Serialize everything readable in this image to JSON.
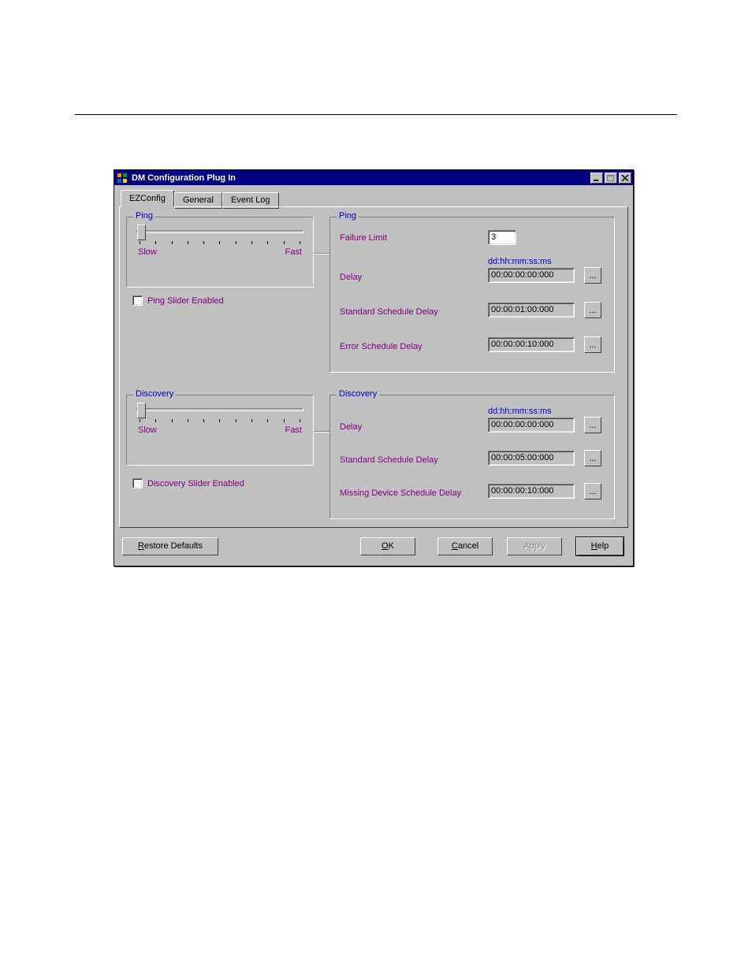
{
  "window": {
    "title": "DM Configuration Plug In"
  },
  "tabs": {
    "ezconfig": "EZConfig",
    "general": "General",
    "eventlog": "Event Log"
  },
  "ping_left": {
    "legend": "Ping",
    "slow": "Slow",
    "fast": "Fast",
    "slider_enabled_label": "Ping Slider Enabled"
  },
  "discovery_left": {
    "legend": "Discovery",
    "slow": "Slow",
    "fast": "Fast",
    "slider_enabled_label": "Discovery Slider Enabled"
  },
  "ping_right": {
    "legend": "Ping",
    "failure_limit_label": "Failure Limit",
    "failure_limit_value": "3",
    "format_hint": "dd:hh:mm:ss:ms",
    "delay_label": "Delay",
    "delay_value": "00:00:00:00:000",
    "std_delay_label": "Standard Schedule Delay",
    "std_delay_value": "00:00:01:00:000",
    "err_delay_label": "Error Schedule Delay",
    "err_delay_value": "00:00:00:10:000",
    "browse": "..."
  },
  "discovery_right": {
    "legend": "Discovery",
    "format_hint": "dd:hh:mm:ss:ms",
    "delay_label": "Delay",
    "delay_value": "00:00:00:00:000",
    "std_delay_label": "Standard Schedule Delay",
    "std_delay_value": "00:00:05:00:000",
    "missing_delay_label": "Missing Device Schedule Delay",
    "missing_delay_value": "00:00:00:10:000",
    "browse": "..."
  },
  "buttons": {
    "restore": "Restore Defaults",
    "ok": "OK",
    "cancel": "Cancel",
    "apply": "Apply",
    "help": "Help"
  }
}
